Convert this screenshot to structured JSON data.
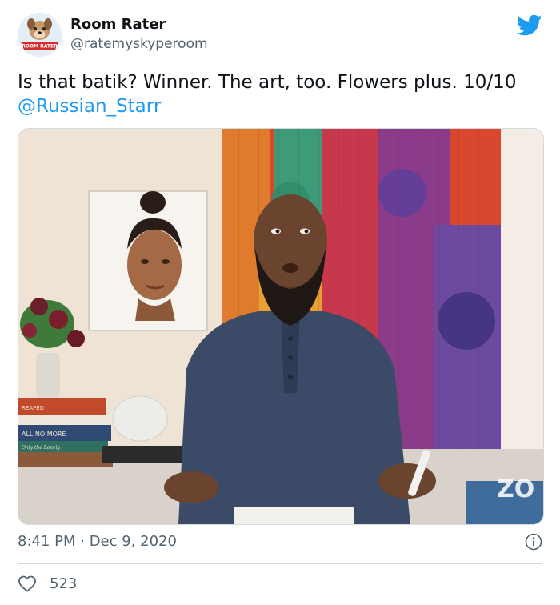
{
  "tweet": {
    "author_name": "Room Rater",
    "author_handle": "@ratemyskyperoom",
    "avatar_label": "ROOM RATER",
    "text": "Is that batik? Winner. The art, too. Flowers plus. 10/10",
    "mention": "@Russian_Starr",
    "timestamp": "8:41 PM · Dec 9, 2020",
    "like_count": "523"
  },
  "media": {
    "book_spine_1": "REAPED",
    "book_spine_2": "ALL NO MORE",
    "book_spine_3": "Only the Lonely",
    "watermark": "ZO"
  },
  "colors": {
    "twitter_blue": "#1d9bf0",
    "text_primary": "#0f1419",
    "text_secondary": "#536471",
    "shirt": "#3b4a66"
  },
  "icons": {
    "brand": "twitter-bird-icon",
    "info": "info-icon",
    "like": "heart-icon"
  }
}
